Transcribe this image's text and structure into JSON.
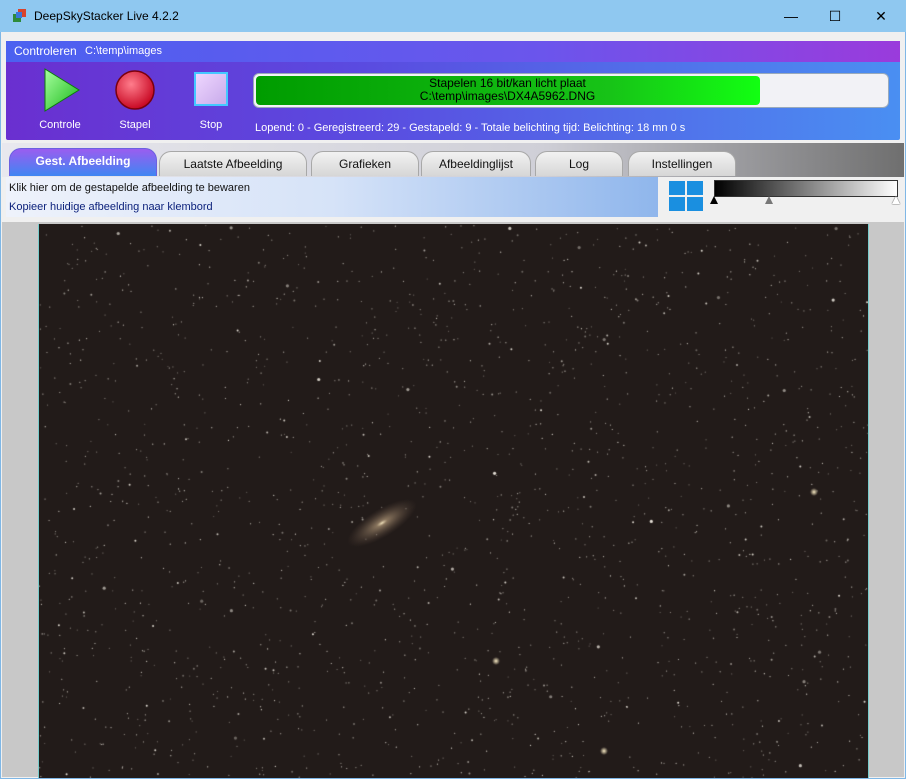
{
  "window": {
    "title": "DeepSkyStacker Live 4.2.2",
    "minimize_label": "—",
    "maximize_label": "☐",
    "close_label": "✕"
  },
  "control": {
    "header_label": "Controleren",
    "folder_path": "C:\\temp\\images",
    "buttons": [
      {
        "label": "Controle",
        "icon": "play-icon"
      },
      {
        "label": "Stapel",
        "icon": "record-icon"
      },
      {
        "label": "Stop",
        "icon": "stop-icon"
      }
    ],
    "progress": {
      "line1": "Stapelen 16 bit/kan  licht plaat",
      "line2": "C:\\temp\\images\\DX4A5962.DNG",
      "fraction": 0.8
    },
    "status": "Lopend: 0 - Geregistreerd: 29 - Gestapeld: 9 - Totale belichting tijd: Belichting: 18 mn 0 s"
  },
  "tabs": [
    {
      "label": "Gest. Afbeelding",
      "active": true
    },
    {
      "label": "Laatste Afbeelding",
      "active": false
    },
    {
      "label": "Grafieken",
      "active": false
    },
    {
      "label": "Afbeeldinglijst",
      "active": false
    },
    {
      "label": "Log",
      "active": false
    },
    {
      "label": "Instellingen",
      "active": false
    }
  ],
  "actions": {
    "save": "Klik hier om de gestapelde afbeelding te bewaren",
    "copy": "Kopieer huidige afbeelding naar klembord"
  },
  "levels": {
    "black": 0.0,
    "mid": 0.3,
    "white": 1.0
  },
  "colors": {
    "accent": "#4a8ff2",
    "progress": "#12ff12",
    "sky": "#221b19"
  }
}
